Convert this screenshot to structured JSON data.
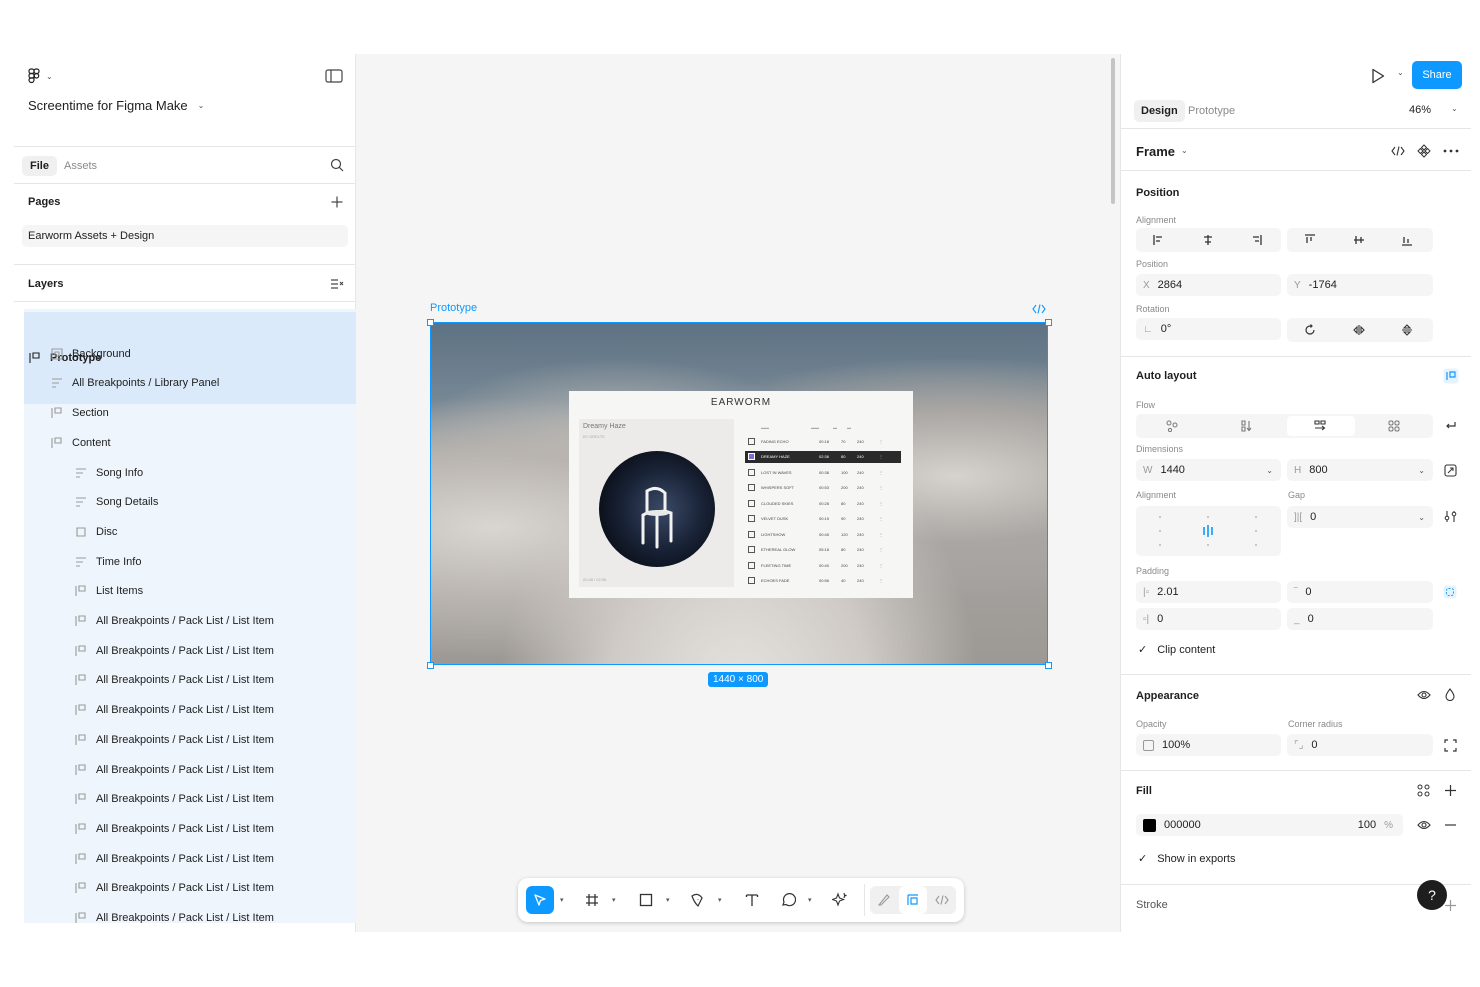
{
  "app": {
    "file_name": "Screentime for Figma Make"
  },
  "left": {
    "tabs": [
      "File",
      "Assets"
    ],
    "pages_heading": "Pages",
    "page": "Earworm Assets + Design",
    "layers_heading": "Layers",
    "layers": [
      {
        "label": "Prototype",
        "level": 0
      },
      {
        "label": "Background",
        "level": 1
      },
      {
        "label": "All Breakpoints / Library Panel",
        "level": 1
      },
      {
        "label": "Section",
        "level": 2
      },
      {
        "label": "Content",
        "level": 2
      },
      {
        "label": "Song Info",
        "level": 3
      },
      {
        "label": "Song Details",
        "level": 4
      },
      {
        "label": "Disc",
        "level": 4
      },
      {
        "label": "Time Info",
        "level": 4
      },
      {
        "label": "List Items",
        "level": 3
      },
      {
        "label": "All Breakpoints / Pack List / List Item",
        "level": 4
      },
      {
        "label": "All Breakpoints / Pack List / List Item",
        "level": 4
      },
      {
        "label": "All Breakpoints / Pack List / List Item",
        "level": 4
      },
      {
        "label": "All Breakpoints / Pack List / List Item",
        "level": 4
      },
      {
        "label": "All Breakpoints / Pack List / List Item",
        "level": 4
      },
      {
        "label": "All Breakpoints / Pack List / List Item",
        "level": 4
      },
      {
        "label": "All Breakpoints / Pack List / List Item",
        "level": 4
      },
      {
        "label": "All Breakpoints / Pack List / List Item",
        "level": 4
      },
      {
        "label": "All Breakpoints / Pack List / List Item",
        "level": 4
      },
      {
        "label": "All Breakpoints / Pack List / List Item",
        "level": 4
      },
      {
        "label": "All Breakpoints / Pack List / List Item",
        "level": 4
      }
    ]
  },
  "canvas": {
    "frame_label": "Prototype",
    "frame_size": "1440 × 800",
    "player": {
      "brand": "EARWORM",
      "song_title": "Dreamy Haze",
      "song_artist": "BY DRELTE",
      "time": "00:48 / 02:36",
      "tracks": [
        {
          "name": "FADING ECHO",
          "time": "00:18",
          "a": "70",
          "b": "240"
        },
        {
          "name": "DREAMY HAZE",
          "time": "02:36",
          "a": "80",
          "b": "240"
        },
        {
          "name": "LOST IN WAVES",
          "time": "00:38",
          "a": "100",
          "b": "240"
        },
        {
          "name": "WHISPERS SOFT",
          "time": "00:53",
          "a": "200",
          "b": "240"
        },
        {
          "name": "CLOUDED SKIES",
          "time": "00:28",
          "a": "80",
          "b": "240"
        },
        {
          "name": "VELVET DUSK",
          "time": "00:15",
          "a": "90",
          "b": "240"
        },
        {
          "name": "LIGHTSHOW",
          "time": "00:45",
          "a": "120",
          "b": "240"
        },
        {
          "name": "ETHEREAL GLOW",
          "time": "05:18",
          "a": "80",
          "b": "240"
        },
        {
          "name": "FLEETING TIME",
          "time": "00:40",
          "a": "200",
          "b": "240"
        },
        {
          "name": "ECHOES FADE",
          "time": "00:56",
          "a": "40",
          "b": "240"
        }
      ]
    }
  },
  "right": {
    "share_label": "Share",
    "tabs": [
      "Design",
      "Prototype"
    ],
    "zoom": "46%",
    "selection_type": "Frame",
    "position": {
      "heading": "Position",
      "alignment_label": "Alignment",
      "position_label": "Position",
      "x_prefix": "X",
      "x": "2864",
      "y_prefix": "Y",
      "y": "-1764",
      "rotation_label": "Rotation",
      "rotation": "0°"
    },
    "auto_layout": {
      "heading": "Auto layout",
      "flow_label": "Flow",
      "dimensions_label": "Dimensions",
      "w_prefix": "W",
      "w": "1440",
      "h_prefix": "H",
      "h": "800",
      "alignment_label": "Alignment",
      "gap_label": "Gap",
      "gap": "0",
      "padding_label": "Padding",
      "padding_left": "2.01",
      "padding_top": "0",
      "padding_right": "0",
      "padding_bottom": "0",
      "clip_content": "Clip content"
    },
    "appearance": {
      "heading": "Appearance",
      "opacity_label": "Opacity",
      "opacity": "100%",
      "corner_label": "Corner radius",
      "corner": "0"
    },
    "fill": {
      "heading": "Fill",
      "hex": "000000",
      "opacity": "100",
      "pct": "%",
      "swatch_color": "#000000",
      "show_in_exports": "Show in exports"
    },
    "stroke": {
      "heading": "Stroke"
    }
  },
  "colors": {
    "accent": "#0d99ff"
  }
}
